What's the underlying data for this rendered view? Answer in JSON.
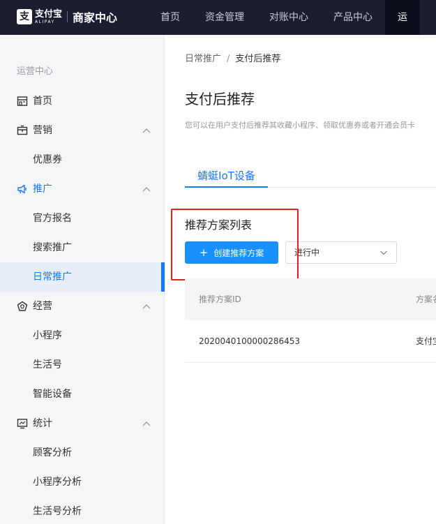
{
  "header": {
    "logo_cn": "支付宝",
    "logo_en": "ALIPAY",
    "app_title": "商家中心",
    "nav": [
      {
        "label": "首页"
      },
      {
        "label": "资金管理"
      },
      {
        "label": "对账中心"
      },
      {
        "label": "产品中心"
      },
      {
        "label": "运"
      }
    ]
  },
  "sidebar": {
    "section_title": "运营中心",
    "items": [
      {
        "label": "首页",
        "icon": "store-icon"
      },
      {
        "label": "营销",
        "icon": "wallet-icon",
        "expanded": true
      },
      {
        "label": "优惠券"
      },
      {
        "label": "推广",
        "icon": "megaphone-icon",
        "expanded": true
      },
      {
        "label": "官方报名"
      },
      {
        "label": "搜索推广"
      },
      {
        "label": "日常推广",
        "selected": true
      },
      {
        "label": "经营",
        "icon": "pentagon-icon",
        "expanded": true
      },
      {
        "label": "小程序"
      },
      {
        "label": "生活号"
      },
      {
        "label": "智能设备"
      },
      {
        "label": "统计",
        "icon": "chart-icon",
        "expanded": true
      },
      {
        "label": "顾客分析"
      },
      {
        "label": "小程序分析"
      },
      {
        "label": "生活号分析"
      }
    ]
  },
  "main": {
    "breadcrumb": {
      "parent": "日常推广",
      "separator": "/",
      "current": "支付后推荐"
    },
    "title": "支付后推荐",
    "description": "您可以在用户支付后推荐其收藏小程序、领取优惠券或者开通会员卡",
    "tabs": [
      {
        "label": "蜻蜓IoT设备",
        "active": true
      }
    ],
    "list_title": "推荐方案列表",
    "create_button": "创建推荐方案",
    "status_filter": {
      "selected": "进行中"
    },
    "table": {
      "columns": [
        "推荐方案ID",
        "方案名"
      ],
      "rows": [
        [
          "2020040100000286453",
          "支付宝"
        ]
      ]
    }
  },
  "colors": {
    "topbar": "#1b1e31",
    "accent": "#1677ff",
    "highlight_box": "#e0221b"
  }
}
